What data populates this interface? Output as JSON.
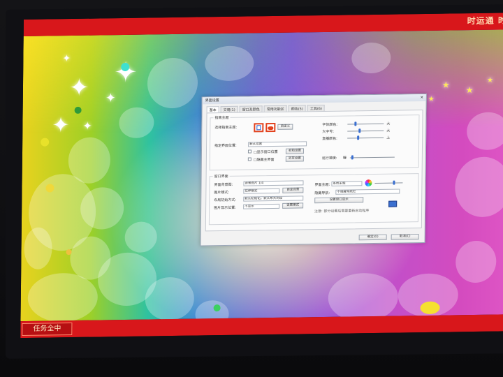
{
  "topbar": {
    "brand": "时运通  时"
  },
  "taskbar": {
    "task_button": "任务全中"
  },
  "dialog": {
    "title": "界面设置",
    "close": "×",
    "tabs": [
      "基本",
      "交易(1)",
      "窗口及颜色",
      "常用功能区",
      "颜色(5)",
      "工具(6)"
    ],
    "theme_group": {
      "title": "指南主题",
      "theme_label": "选择指南主题:",
      "custom_button": "自定义",
      "right_labels": [
        "字体颜色:",
        "大字号:",
        "直播颜色:"
      ],
      "right_values": [
        "大",
        "大",
        "上"
      ],
      "browse_label": "指定界面位置:",
      "browse_value": "默认位置",
      "check1_label": "□显示窗口位置",
      "check2_label": "□隐藏主界面",
      "btn1": "初始设置",
      "btn2": "另存设置",
      "speed_label": "运行速度:",
      "speed_value": "慢"
    },
    "ui_group": {
      "title": "窗口界面",
      "rows": [
        {
          "label": "界面背景图:",
          "value": "背景图片  1/4",
          "button": ""
        },
        {
          "label": "图片模式:",
          "value": "拉伸模式",
          "button": "自定背景"
        },
        {
          "label": "布局初始方式:",
          "value": "默认初始化，默认布大到设",
          "button": ""
        },
        {
          "label": "图片显示位置:",
          "value": "不显示",
          "button": "设置模式"
        }
      ],
      "right_labels": [
        "界面主题:",
        "隐藏导航:"
      ],
      "right_values": [
        "系统主题",
        "不隐藏导航栏"
      ],
      "save_button": "设置窗口显示",
      "hint": "注意: 部分设置后需要重新启动程序"
    },
    "ok": "确定(O)",
    "cancel": "取消(C)"
  },
  "colors": {
    "topbar": "#d8171b",
    "dialog_bg": "#f2f2f2",
    "accent": "#3a6fd0"
  }
}
